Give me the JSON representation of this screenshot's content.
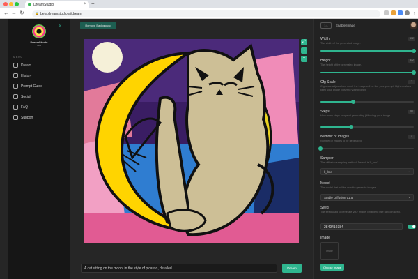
{
  "browser": {
    "tab_title": "DreamStudio",
    "url": "beta.dreamstudio.ai/dream"
  },
  "sidebar": {
    "brand": "DreamStudio",
    "brand_sub": "beta",
    "menu_title": "MENU",
    "items": [
      {
        "label": "Dream",
        "icon": "dream-icon"
      },
      {
        "label": "History",
        "icon": "history-icon"
      },
      {
        "label": "Prompt Guide",
        "icon": "guide-icon"
      },
      {
        "label": "Social",
        "icon": "social-icon"
      },
      {
        "label": "FAQ",
        "icon": "faq-icon"
      },
      {
        "label": "Support",
        "icon": "support-icon"
      }
    ]
  },
  "main": {
    "top_button": "Remove Background",
    "prompt": "A cat sitting on the moon, in the style of picasso, detailed",
    "dream_button": "Dream"
  },
  "panel": {
    "top_label": "Enable Image",
    "top_box": "1:1",
    "width": {
      "label": "Width",
      "desc": "The width of the generated image.",
      "value": "512",
      "fraction": 1.0
    },
    "height": {
      "label": "Height",
      "desc": "The height of the generated image.",
      "value": "512",
      "fraction": 1.0
    },
    "cfg": {
      "label": "Cfg Scale",
      "desc": "Cfg scale adjusts how much the image will be like your prompt. Higher values keep your image closer to your prompt.",
      "value": "7",
      "fraction": 0.35
    },
    "steps": {
      "label": "Steps",
      "desc": "How many steps to spend generating (diffusing) your image.",
      "value": "50",
      "fraction": 0.33
    },
    "images": {
      "label": "Number of Images",
      "desc": "Number of images to be generated.",
      "value": "1",
      "fraction": 0.0
    },
    "sampler": {
      "label": "Sampler",
      "desc": "The diffusion sampling method. Default is 'k_lms'.",
      "value": "k_lms"
    },
    "model": {
      "label": "Model",
      "desc": "The model that will be used to generate images.",
      "value": "Stable Diffusion v1.5"
    },
    "seed": {
      "label": "Seed",
      "desc": "The seed used to generate your image. Enable to use random seed.",
      "value": "2849419384"
    },
    "image": {
      "label": "Image",
      "placeholder": "Image",
      "button": "Choose Image"
    }
  },
  "colors": {
    "accent": "#2fb58f",
    "sidebar_bg": "#161616",
    "panel_bg": "#222222"
  }
}
